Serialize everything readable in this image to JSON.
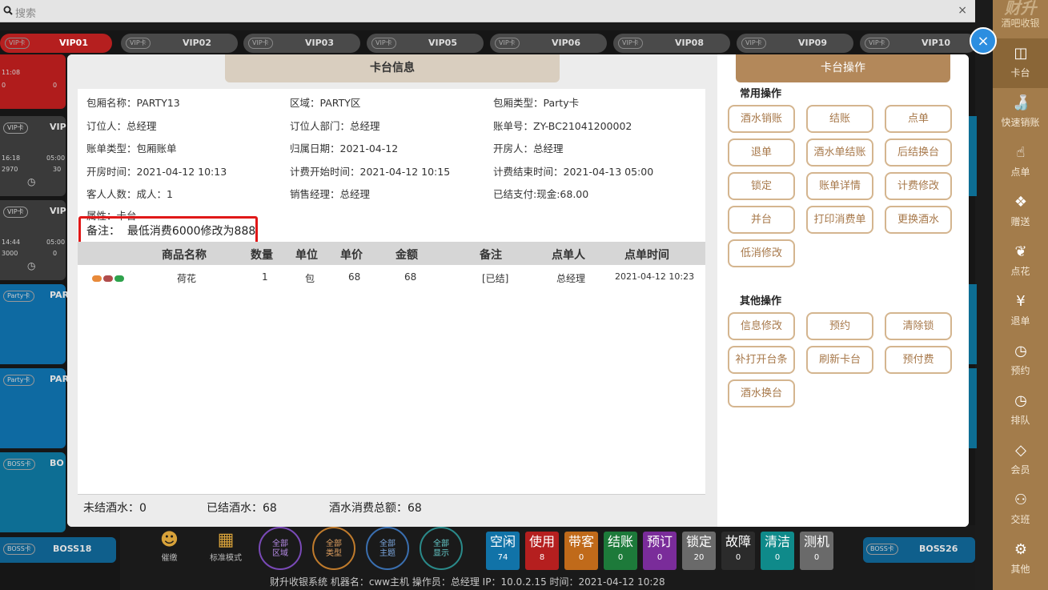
{
  "search": {
    "placeholder": "搜索",
    "clear": "×"
  },
  "vip_tabs": [
    {
      "tag": "VIP卡",
      "name": "VIP01"
    },
    {
      "tag": "VIP卡",
      "name": "VIP02"
    },
    {
      "tag": "VIP卡",
      "name": "VIP03"
    },
    {
      "tag": "VIP卡",
      "name": "VIP05"
    },
    {
      "tag": "VIP卡",
      "name": "VIP06"
    },
    {
      "tag": "VIP卡",
      "name": "VIP08"
    },
    {
      "tag": "VIP卡",
      "name": "VIP09"
    },
    {
      "tag": "VIP卡",
      "name": "VIP10"
    }
  ],
  "left_tiles": [
    {
      "tag": "VIP卡",
      "name": "VIP",
      "time": "11:08",
      "amount": "0",
      "extra": "0"
    },
    {
      "tag": "VIP卡",
      "name": "VIP",
      "time": "16:18",
      "time2": "05:00",
      "amount": "2970",
      "extra": "30"
    },
    {
      "tag": "VIP卡",
      "name": "VIP",
      "time": "14:44",
      "time2": "05:00",
      "amount": "3000",
      "extra": "0"
    },
    {
      "tag": "Party卡",
      "name": "PAR"
    },
    {
      "tag": "Party卡",
      "name": "PAR"
    },
    {
      "tag": "BOSS卡",
      "name": "BO"
    }
  ],
  "brand": {
    "top": "财升",
    "sub": "酒吧收银"
  },
  "nav": [
    {
      "icon": "table-icon",
      "glyph": "◫",
      "label": "卡台"
    },
    {
      "icon": "bottle-icon",
      "glyph": "🍶",
      "label": "快速销账"
    },
    {
      "icon": "pointer-icon",
      "glyph": "☝",
      "label": "点单"
    },
    {
      "icon": "gift-icon",
      "glyph": "❖",
      "label": "赠送"
    },
    {
      "icon": "flower-icon",
      "glyph": "❦",
      "label": "点花"
    },
    {
      "icon": "yen-icon",
      "glyph": "¥",
      "label": "退单"
    },
    {
      "icon": "clock-icon",
      "glyph": "◷",
      "label": "预约"
    },
    {
      "icon": "queue-icon",
      "glyph": "◷",
      "label": "排队"
    },
    {
      "icon": "diamond-icon",
      "glyph": "◇",
      "label": "会员"
    },
    {
      "icon": "users-icon",
      "glyph": "⚇",
      "label": "交班"
    },
    {
      "icon": "gear-icon",
      "glyph": "⚙",
      "label": "其他"
    }
  ],
  "modal": {
    "info_tab": "卡台信息",
    "op_tab": "卡台操作",
    "info": [
      {
        "label": "包厢名称：",
        "value": "PARTY13"
      },
      {
        "label": "区域：",
        "value": "PARTY区"
      },
      {
        "label": "包厢类型：",
        "value": "Party卡"
      },
      {
        "label": "订位人：",
        "value": "总经理"
      },
      {
        "label": "订位人部门：",
        "value": "总经理"
      },
      {
        "label": "账单号：",
        "value": "ZY-BC21041200002"
      },
      {
        "label": "账单类型：",
        "value": "包厢账单"
      },
      {
        "label": "归属日期：",
        "value": "2021-04-12"
      },
      {
        "label": "开房人：",
        "value": "总经理"
      },
      {
        "label": "开房时间：",
        "value": "2021-04-12 10:13"
      },
      {
        "label": "计费开始时间：",
        "value": "2021-04-12 10:15"
      },
      {
        "label": "计费结束时间：",
        "value": "2021-04-13 05:00"
      },
      {
        "label": "客人人数：",
        "value": "成人：1"
      },
      {
        "label": "销售经理：",
        "value": "总经理"
      },
      {
        "label": "已结支付:",
        "value": "现金:68.00"
      },
      {
        "label": "属性：",
        "value": "卡台"
      }
    ],
    "remark": {
      "label": "备注：",
      "value": "最低消费6000修改为888"
    },
    "table": {
      "headers": [
        "商品名称",
        "数量",
        "单位",
        "单价",
        "金额",
        "备注",
        "点单人",
        "点单时间"
      ],
      "rows": [
        {
          "name": "荷花",
          "qty": "1",
          "unit": "包",
          "price": "68",
          "amount": "68",
          "note": "[已结]",
          "orderer": "总经理",
          "time": "2021-04-12 10:23"
        }
      ]
    },
    "summary": {
      "unsettled": "未结酒水：0",
      "settled": "已结酒水：68",
      "total": "酒水消费总额：68"
    },
    "common_title": "常用操作",
    "common_ops": [
      "酒水销账",
      "结账",
      "点单",
      "退单",
      "酒水单结账",
      "后结换台",
      "锁定",
      "账单详情",
      "计费修改",
      "并台",
      "打印消费单",
      "更换酒水",
      "低消修改"
    ],
    "other_title": "其他操作",
    "other_ops": [
      "信息修改",
      "预约",
      "清除锁",
      "补打开台条",
      "刷新卡台",
      "预付费",
      "酒水换台"
    ]
  },
  "bottom": {
    "left_tile": {
      "tag": "BOSS卡",
      "name": "BOSS18"
    },
    "right_tile": {
      "tag": "BOSS卡",
      "name": "BOSS26"
    },
    "urge": "催缴",
    "mode": "标准模式",
    "circles": [
      {
        "l1": "全部",
        "l2": "区域"
      },
      {
        "l1": "全部",
        "l2": "类型"
      },
      {
        "l1": "全部",
        "l2": "主题"
      },
      {
        "l1": "全部",
        "l2": "显示"
      }
    ],
    "stats": [
      {
        "label": "空闲",
        "count": "74",
        "color": "#1173a8"
      },
      {
        "label": "使用",
        "count": "8",
        "color": "#b51f1f"
      },
      {
        "label": "带客",
        "count": "0",
        "color": "#c06a1a"
      },
      {
        "label": "结账",
        "count": "0",
        "color": "#1d7a3a"
      },
      {
        "label": "预订",
        "count": "0",
        "color": "#7a2c9a"
      },
      {
        "label": "锁定",
        "count": "20",
        "color": "#6a6a6a"
      },
      {
        "label": "故障",
        "count": "0",
        "color": "#2b2b2b"
      },
      {
        "label": "清洁",
        "count": "0",
        "color": "#0f8a8a"
      },
      {
        "label": "测机",
        "count": "0",
        "color": "#6a6a6a"
      }
    ],
    "footer": "财升收银系统     机器名：cww主机    操作员：总经理    IP：10.0.2.15    时间：2021-04-12 10:28"
  },
  "close_label": "×"
}
